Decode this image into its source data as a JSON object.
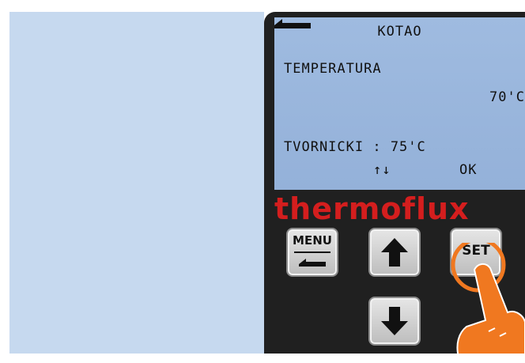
{
  "screen": {
    "title": "KOTAO",
    "label": "TEMPERATURA",
    "value": "70'C",
    "factory": "TVORNICKI : 75'C",
    "nav_updown": "↑↓",
    "nav_ok": "OK"
  },
  "brand": "thermoflux",
  "buttons": {
    "menu_label": "MENU",
    "set_label": "SET"
  },
  "icons": {
    "back": "back-arrow-icon",
    "up": "arrow-up-icon",
    "down": "arrow-down-icon",
    "pointer": "hand-pointer-icon"
  },
  "colors": {
    "lcd": "#9fbbe0",
    "panel": "#c6d9ef",
    "device": "#202020",
    "brand": "#d41e1e",
    "highlight": "#f07820"
  }
}
